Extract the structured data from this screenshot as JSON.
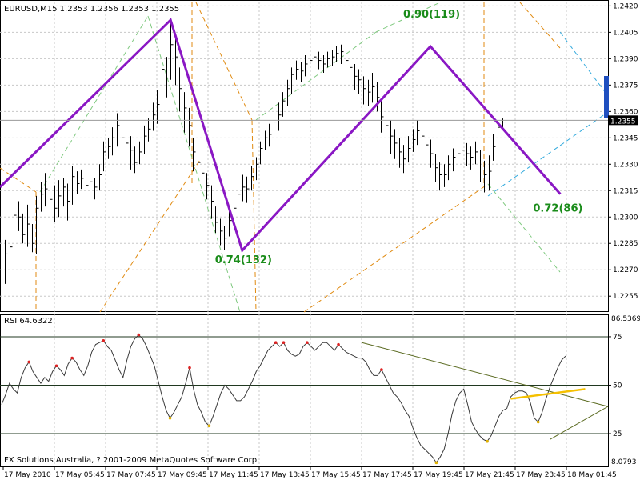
{
  "chart_data": [
    {
      "type": "candlestick",
      "title": "EURUSD,M15  1.2353 1.2356 1.2353 1.2355",
      "symbol": "EURUSD",
      "timeframe": "M15",
      "ohlc_header": [
        1.2353,
        1.2356,
        1.2353,
        1.2355
      ],
      "current_price": 1.2355,
      "current_price_label": "1.2355",
      "ylim": [
        1.2246,
        1.2422
      ],
      "y_ticks": [
        1.242,
        1.2405,
        1.239,
        1.2375,
        1.236,
        1.2345,
        1.233,
        1.2315,
        1.23,
        1.2285,
        1.227,
        1.2255
      ],
      "y_tick_labels": [
        "1.2420",
        "1.2405",
        "1.2390",
        "1.2375",
        "1.2360",
        "1.2345",
        "1.2330",
        "1.2315",
        "1.2300",
        "1.2285",
        "1.2270",
        "1.2255"
      ],
      "grid": true,
      "bars": [
        [
          1.2287,
          1.2279,
          1.2262
        ],
        [
          1.2291,
          1.2283,
          1.227
        ],
        [
          1.2306,
          1.2301,
          1.2287
        ],
        [
          1.2309,
          1.23,
          1.2292
        ],
        [
          1.2302,
          1.229,
          1.2285
        ],
        [
          1.2307,
          1.2296,
          1.2283
        ],
        [
          1.2296,
          1.2285,
          1.228
        ],
        [
          1.2312,
          1.2305,
          1.2279
        ],
        [
          1.232,
          1.2313,
          1.2303
        ],
        [
          1.2325,
          1.2316,
          1.2306
        ],
        [
          1.232,
          1.231,
          1.2302
        ],
        [
          1.2318,
          1.2305,
          1.2297
        ],
        [
          1.2321,
          1.2312,
          1.23
        ],
        [
          1.2322,
          1.2317,
          1.2306
        ],
        [
          1.2319,
          1.2309,
          1.2298
        ],
        [
          1.2329,
          1.2323,
          1.2307
        ],
        [
          1.2326,
          1.2319,
          1.2313
        ],
        [
          1.2327,
          1.2322,
          1.2316
        ],
        [
          1.2331,
          1.2318,
          1.2311
        ],
        [
          1.2327,
          1.232,
          1.2313
        ],
        [
          1.2322,
          1.2317,
          1.231
        ],
        [
          1.233,
          1.2324,
          1.2315
        ],
        [
          1.2343,
          1.2337,
          1.2326
        ],
        [
          1.2345,
          1.234,
          1.2333
        ],
        [
          1.2351,
          1.2345,
          1.2335
        ],
        [
          1.2359,
          1.2352,
          1.234
        ],
        [
          1.2355,
          1.2345,
          1.2336
        ],
        [
          1.2349,
          1.2342,
          1.2333
        ],
        [
          1.2346,
          1.2338,
          1.2327
        ],
        [
          1.234,
          1.2331,
          1.2325
        ],
        [
          1.2343,
          1.2337,
          1.233
        ],
        [
          1.2352,
          1.2346,
          1.2336
        ],
        [
          1.2356,
          1.235,
          1.2343
        ],
        [
          1.2365,
          1.2358,
          1.2349
        ],
        [
          1.2372,
          1.2364,
          1.2353
        ],
        [
          1.2395,
          1.2384,
          1.2366
        ],
        [
          1.2391,
          1.2379,
          1.2368
        ],
        [
          1.241,
          1.2398,
          1.2378
        ],
        [
          1.2403,
          1.2391,
          1.2375
        ],
        [
          1.2385,
          1.2373,
          1.236
        ],
        [
          1.2371,
          1.2362,
          1.2348
        ],
        [
          1.2362,
          1.2352,
          1.234
        ],
        [
          1.2345,
          1.2337,
          1.2326
        ],
        [
          1.234,
          1.2331,
          1.2323
        ],
        [
          1.2332,
          1.2325,
          1.2316
        ],
        [
          1.2325,
          1.2318,
          1.231
        ],
        [
          1.2318,
          1.2309,
          1.2299
        ],
        [
          1.2306,
          1.2297,
          1.2291
        ],
        [
          1.2299,
          1.2292,
          1.2284
        ],
        [
          1.2295,
          1.2288,
          1.2281
        ],
        [
          1.2304,
          1.2298,
          1.2289
        ],
        [
          1.2311,
          1.2305,
          1.2296
        ],
        [
          1.2318,
          1.2313,
          1.2303
        ],
        [
          1.2324,
          1.2317,
          1.2309
        ],
        [
          1.2323,
          1.2316,
          1.2308
        ],
        [
          1.2329,
          1.2323,
          1.2315
        ],
        [
          1.2334,
          1.233,
          1.2321
        ],
        [
          1.2343,
          1.2339,
          1.233
        ],
        [
          1.2349,
          1.2345,
          1.2338
        ],
        [
          1.2353,
          1.2347,
          1.234
        ],
        [
          1.2361,
          1.2354,
          1.2345
        ],
        [
          1.2365,
          1.2358,
          1.2349
        ],
        [
          1.2371,
          1.2366,
          1.2357
        ],
        [
          1.2378,
          1.2373,
          1.2363
        ],
        [
          1.2385,
          1.2381,
          1.237
        ],
        [
          1.2389,
          1.2384,
          1.2378
        ],
        [
          1.2388,
          1.2383,
          1.2377
        ],
        [
          1.2392,
          1.2387,
          1.238
        ],
        [
          1.2393,
          1.2389,
          1.2384
        ],
        [
          1.2396,
          1.2391,
          1.2385
        ],
        [
          1.2394,
          1.2389,
          1.2384
        ],
        [
          1.2392,
          1.2387,
          1.2382
        ],
        [
          1.2394,
          1.239,
          1.2385
        ],
        [
          1.2395,
          1.2391,
          1.2386
        ],
        [
          1.2397,
          1.2393,
          1.2388
        ],
        [
          1.2398,
          1.2394,
          1.2387
        ],
        [
          1.2396,
          1.2389,
          1.2382
        ],
        [
          1.2393,
          1.2385,
          1.2377
        ],
        [
          1.2387,
          1.238,
          1.2372
        ],
        [
          1.2384,
          1.2378,
          1.237
        ],
        [
          1.238,
          1.2373,
          1.2364
        ],
        [
          1.2378,
          1.2371,
          1.2363
        ],
        [
          1.2382,
          1.2374,
          1.2365
        ],
        [
          1.2377,
          1.2368,
          1.236
        ],
        [
          1.2366,
          1.2357,
          1.2348
        ],
        [
          1.2361,
          1.2352,
          1.2342
        ],
        [
          1.2355,
          1.2346,
          1.2336
        ],
        [
          1.235,
          1.2342,
          1.2333
        ],
        [
          1.2345,
          1.2337,
          1.2328
        ],
        [
          1.2341,
          1.2333,
          1.2325
        ],
        [
          1.2346,
          1.2339,
          1.2331
        ],
        [
          1.235,
          1.2344,
          1.2337
        ],
        [
          1.2355,
          1.2349,
          1.2341
        ],
        [
          1.2354,
          1.2346,
          1.2338
        ],
        [
          1.2349,
          1.2341,
          1.2333
        ],
        [
          1.2344,
          1.2336,
          1.2328
        ],
        [
          1.2336,
          1.2328,
          1.232
        ],
        [
          1.2331,
          1.2324,
          1.2315
        ],
        [
          1.233,
          1.2324,
          1.2317
        ],
        [
          1.2335,
          1.233,
          1.2321
        ],
        [
          1.2339,
          1.2334,
          1.2326
        ],
        [
          1.2341,
          1.2336,
          1.2329
        ],
        [
          1.2343,
          1.2338,
          1.2332
        ],
        [
          1.2342,
          1.2336,
          1.2329
        ],
        [
          1.234,
          1.2334,
          1.2327
        ],
        [
          1.2343,
          1.2337,
          1.233
        ],
        [
          1.2338,
          1.2329,
          1.232
        ],
        [
          1.2332,
          1.2324,
          1.2314
        ],
        [
          1.2335,
          1.2326,
          1.2315
        ],
        [
          1.2347,
          1.234,
          1.2332
        ],
        [
          1.2356,
          1.2351,
          1.2343
        ],
        [
          1.2356,
          1.2354,
          1.235
        ]
      ],
      "zigzag": {
        "color": "#8a17c4",
        "points": [
          [
            0,
            1.2317
          ],
          [
            37,
            1.2412
          ],
          [
            53,
            1.2281
          ],
          [
            95,
            1.2397
          ],
          [
            124,
            1.2313
          ]
        ],
        "labels": [
          {
            "text": "0.74(132)",
            "anchor": 2,
            "price": 1.2281
          },
          {
            "text": "0.90(119)",
            "anchor": 3,
            "price": 1.2397
          },
          {
            "text": "0.72(86)",
            "anchor": 4,
            "price": 1.2313
          }
        ],
        "label_color": "#1a8c1a"
      },
      "colors": {
        "bars": "#000000",
        "grid": "#c8c8c8",
        "fib_orange": "#e08a10",
        "fib_green": "#7fc97f",
        "channel_blue": "#33aadd",
        "price_box": "#1f4fbf"
      }
    },
    {
      "type": "line",
      "title": "RSI 64.6322",
      "indicator": "RSI",
      "value": 64.6322,
      "ylim": [
        8.0793,
        86.5369
      ],
      "y_ticks": [
        75,
        50,
        25
      ],
      "y_tick_labels": [
        "75",
        "50",
        "25"
      ],
      "y_extremes_labels": [
        "86.5369",
        "8.0793"
      ],
      "levels": [
        75,
        50,
        25
      ],
      "values": [
        40,
        45,
        51,
        48,
        46,
        54,
        59,
        62,
        57,
        54,
        51,
        54,
        52,
        57,
        60,
        58,
        55,
        61,
        64,
        62,
        58,
        55,
        60,
        67,
        71,
        72,
        73,
        70,
        68,
        63,
        58,
        54,
        63,
        70,
        74,
        76,
        74,
        70,
        65,
        60,
        52,
        44,
        37,
        33,
        36,
        40,
        44,
        51,
        59,
        48,
        40,
        36,
        31,
        29,
        34,
        40,
        46,
        50,
        48,
        45,
        42,
        42,
        44,
        48,
        52,
        57,
        60,
        64,
        68,
        70,
        72,
        70,
        72,
        68,
        66,
        65,
        66,
        70,
        72,
        70,
        68,
        70,
        72,
        72,
        70,
        68,
        71,
        69,
        67,
        66,
        65,
        64,
        64,
        62,
        58,
        55,
        55,
        58,
        54,
        50,
        46,
        44,
        41,
        37,
        34,
        28,
        23,
        19,
        17,
        15,
        13,
        10,
        13,
        17,
        25,
        35,
        42,
        46,
        48,
        40,
        31,
        27,
        24,
        22,
        21,
        24,
        29,
        34,
        37,
        38,
        44,
        46,
        47,
        47,
        46,
        41,
        33,
        31,
        36,
        43,
        49,
        54,
        59,
        63,
        65
      ],
      "line_color": "#3a3a3a",
      "trendlines": [
        {
          "from": [
            92,
            72
          ],
          "to": [
            171,
            39
          ],
          "color": "#5a6a20"
        },
        {
          "from": [
            140,
            22
          ],
          "to": [
            171,
            39
          ],
          "color": "#5a6a20"
        },
        {
          "from": [
            130,
            43
          ],
          "to": [
            149,
            48
          ],
          "color": "#f5c000"
        }
      ]
    }
  ],
  "x_axis": {
    "labels": [
      "17 May 2010",
      "17 May 05:45",
      "17 May 07:45",
      "17 May 09:45",
      "17 May 11:45",
      "17 May 13:45",
      "17 May 15:45",
      "17 May 17:45",
      "17 May 19:45",
      "17 May 21:45",
      "17 May 23:45",
      "18 May 01:45"
    ]
  },
  "footer": {
    "copyright": "FX Solutions Australia, ? 2001-2009 MetaQuotes Software Corp."
  }
}
